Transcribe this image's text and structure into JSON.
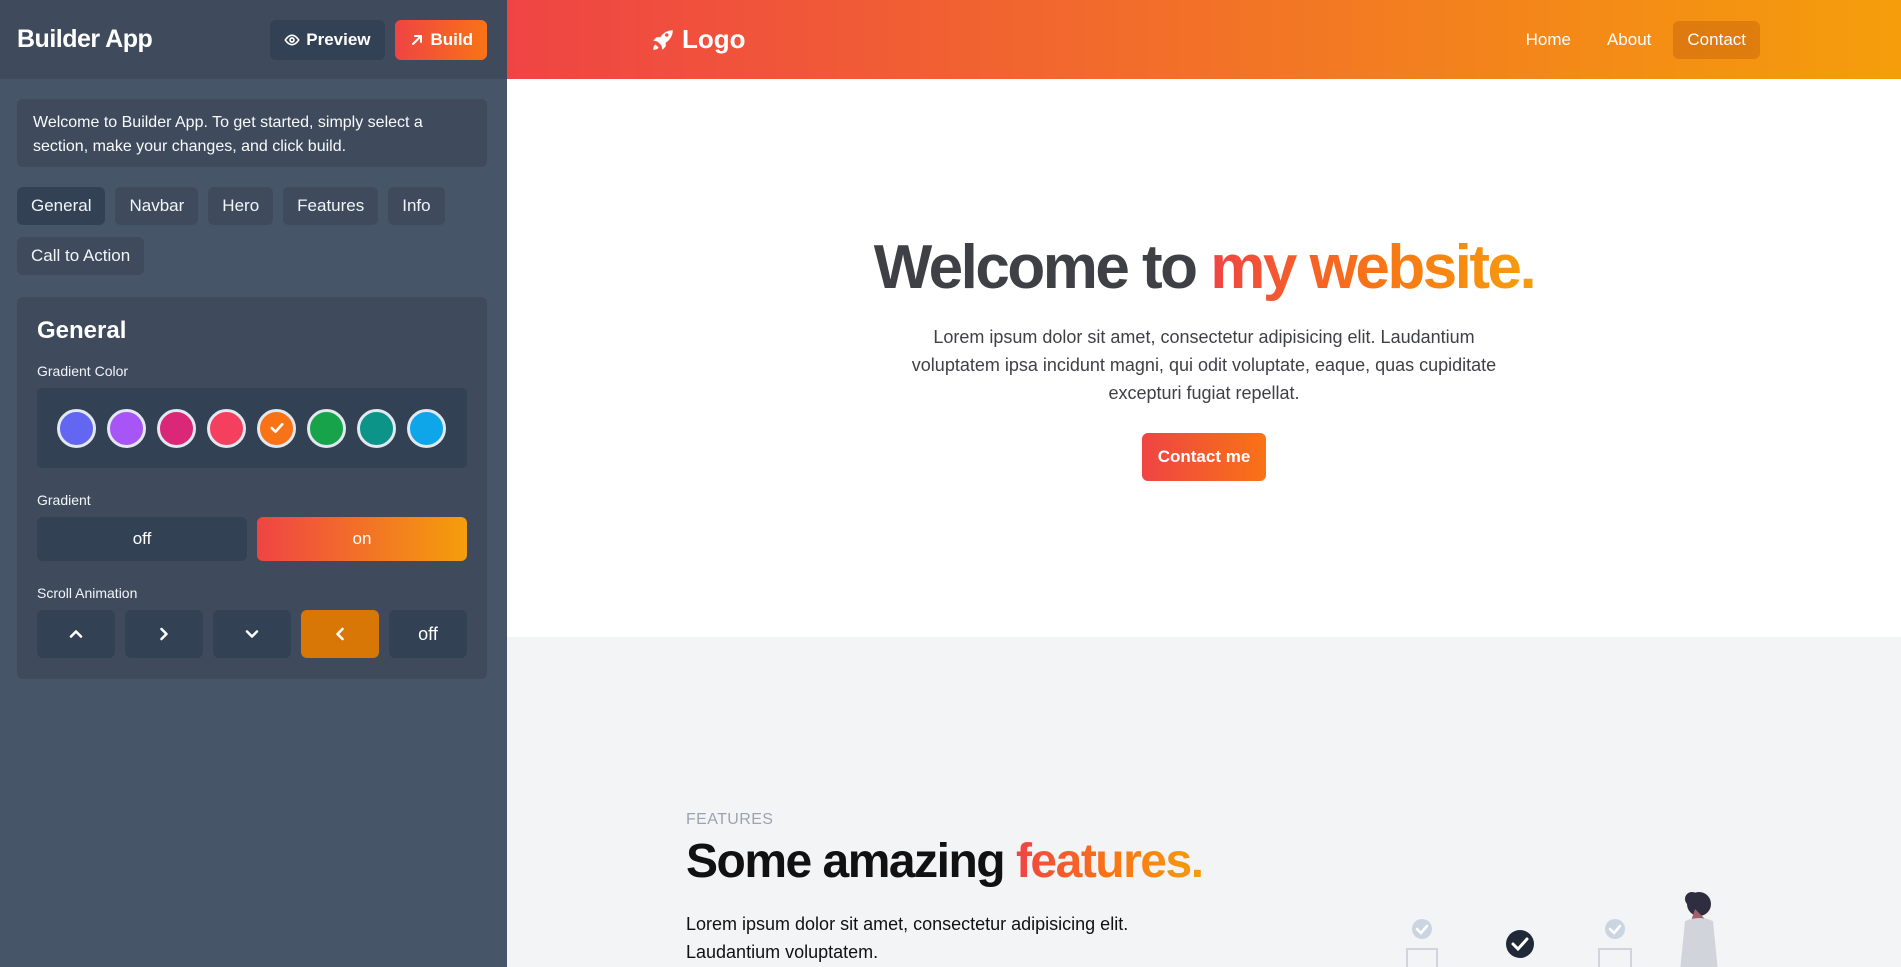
{
  "sidebar": {
    "app_title": "Builder App",
    "preview_label": "Preview",
    "build_label": "Build",
    "welcome_text": "Welcome to Builder App. To get started, simply select a section, make your changes, and click build.",
    "tabs": [
      {
        "label": "General",
        "active": true
      },
      {
        "label": "Navbar",
        "active": false
      },
      {
        "label": "Hero",
        "active": false
      },
      {
        "label": "Features",
        "active": false
      },
      {
        "label": "Info",
        "active": false
      },
      {
        "label": "Call to Action",
        "active": false
      }
    ],
    "panel": {
      "title": "General",
      "gradient_color_label": "Gradient Color",
      "swatches": [
        {
          "color": "#6366f1",
          "selected": false
        },
        {
          "color": "#a855f7",
          "selected": false
        },
        {
          "color": "#db2777",
          "selected": false
        },
        {
          "color": "#f43f5e",
          "selected": false
        },
        {
          "color": "#f97316",
          "selected": true
        },
        {
          "color": "#16a34a",
          "selected": false
        },
        {
          "color": "#0d9488",
          "selected": false
        },
        {
          "color": "#0ea5e9",
          "selected": false
        }
      ],
      "gradient_label": "Gradient",
      "gradient_off": "off",
      "gradient_on": "on",
      "gradient_value": "on",
      "scroll_label": "Scroll Animation",
      "scroll_off": "off",
      "scroll_selected": "left"
    }
  },
  "preview": {
    "logo_text": "Logo",
    "nav": [
      {
        "label": "Home",
        "active": false
      },
      {
        "label": "About",
        "active": false
      },
      {
        "label": "Contact",
        "active": true
      }
    ],
    "hero": {
      "title_plain": "Welcome to ",
      "title_accent": "my website.",
      "subtitle": "Lorem ipsum dolor sit amet, consectetur adipisicing elit. Laudantium voluptatem ipsa incidunt magni, qui odit voluptate, eaque, quas cupiditate excepturi fugiat repellat.",
      "button_label": "Contact me"
    },
    "features": {
      "eyebrow": "FEATURES",
      "title_plain": "Some amazing ",
      "title_accent": "features.",
      "subtitle": "Lorem ipsum dolor sit amet, consectetur adipisicing elit. Laudantium voluptatem."
    }
  },
  "colors": {
    "sidebar_bg": "#475569",
    "accent_start": "#ef4444",
    "accent_end": "#f59e0b",
    "anim_active": "#d97706"
  }
}
